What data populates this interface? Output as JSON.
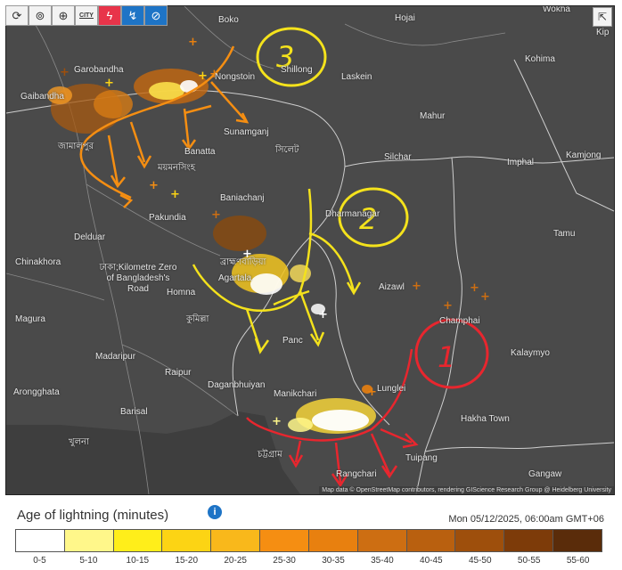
{
  "toolbar": {
    "icons": [
      "refresh-icon",
      "location-pin-icon",
      "zoom-icon",
      "city-icon",
      "lightning-icon",
      "lightning-ground-icon",
      "satellite-icon"
    ],
    "city_label": "CITY",
    "share_icon": "share-icon"
  },
  "map": {
    "places": [
      {
        "key": "boko",
        "text": "Boko"
      },
      {
        "key": "hojai",
        "text": "Hojai"
      },
      {
        "key": "wokha",
        "text": "Wokha"
      },
      {
        "key": "kip",
        "text": "Kip"
      },
      {
        "key": "kohima",
        "text": "Kohima"
      },
      {
        "key": "garobandha",
        "text": "Garobandha"
      },
      {
        "key": "nongstoin",
        "text": "Nongstoin"
      },
      {
        "key": "shillong",
        "text": "Shillong"
      },
      {
        "key": "laskein",
        "text": "Laskein"
      },
      {
        "key": "gaibandha",
        "text": "Gaibandha"
      },
      {
        "key": "mahur",
        "text": "Mahur"
      },
      {
        "key": "sunamganj",
        "text": "Sunamganj"
      },
      {
        "key": "banatta",
        "text": "Banatta"
      },
      {
        "key": "sylhet_bn",
        "text": "সিলেট"
      },
      {
        "key": "silchar",
        "text": "Silchar"
      },
      {
        "key": "imphal",
        "text": "Imphal"
      },
      {
        "key": "kamjong",
        "text": "Kamjong"
      },
      {
        "key": "baniachanj",
        "text": "Baniachanj"
      },
      {
        "key": "dharmanagar",
        "text": "Dharmanagar"
      },
      {
        "key": "pakundia",
        "text": "Pakundia"
      },
      {
        "key": "delduar",
        "text": "Delduar"
      },
      {
        "key": "tamu",
        "text": "Tamu"
      },
      {
        "key": "chinakhora",
        "text": "Chinakhora"
      },
      {
        "key": "agartala",
        "text": "Agartala"
      },
      {
        "key": "dhaka_road",
        "text": "ঢাকা;Kilometre Zero of Bangladesh's Road"
      },
      {
        "key": "homna",
        "text": "Homna"
      },
      {
        "key": "aizawl",
        "text": "Aizawl"
      },
      {
        "key": "magura",
        "text": "Magura"
      },
      {
        "key": "comilla_bn",
        "text": "কুমিল্লা"
      },
      {
        "key": "champhai",
        "text": "Champhai"
      },
      {
        "key": "panchari",
        "text": "Panc"
      },
      {
        "key": "kalaymyo",
        "text": "Kalaymyo"
      },
      {
        "key": "madaripur",
        "text": "Madaripur"
      },
      {
        "key": "raipur",
        "text": "Raipur"
      },
      {
        "key": "daganbhuiyan",
        "text": "Daganbhuiyan"
      },
      {
        "key": "manikchari",
        "text": "Manikchari"
      },
      {
        "key": "lunglei",
        "text": "Lunglei"
      },
      {
        "key": "arongghata",
        "text": "Arongghata"
      },
      {
        "key": "barisal",
        "text": "Barisal"
      },
      {
        "key": "hakha",
        "text": "Hakha Town"
      },
      {
        "key": "tuipang",
        "text": "Tuipang"
      },
      {
        "key": "gangaw",
        "text": "Gangaw"
      },
      {
        "key": "khulna_bn",
        "text": "খুলনা"
      },
      {
        "key": "chittagong_bn",
        "text": "চট্টগ্রাম"
      },
      {
        "key": "rangamati",
        "text": "Rangchari"
      },
      {
        "key": "mymensingh_bn",
        "text": "ময়মনসিংহ"
      },
      {
        "key": "jamalpur_bn",
        "text": "জামালপুর"
      },
      {
        "key": "brahmanbaria_bn",
        "text": "ব্রাহ্মণবাড়িয়া"
      }
    ],
    "annotations": [
      {
        "number": "1",
        "color": "#e8262e"
      },
      {
        "number": "2",
        "color": "#f4e21c"
      },
      {
        "number": "3",
        "color": "#f4e21c"
      }
    ],
    "attribution": "Map data © OpenStreetMap contributors, rendering GIScience Research Group @ Heidelberg University"
  },
  "legend": {
    "title": "Age of lightning (minutes)",
    "info_icon": "info-icon",
    "timestamp": "Mon 05/12/2025, 06:00am GMT+06",
    "colors": [
      "#ffffff",
      "#fff78a",
      "#ffee1a",
      "#fcd414",
      "#f9b81b",
      "#f58e12",
      "#e8800f",
      "#cd6e12",
      "#b9600f",
      "#9e4f0c",
      "#7d3b09",
      "#5a2c0a"
    ],
    "labels": [
      "0-5",
      "5-10",
      "10-15",
      "15-20",
      "20-25",
      "25-30",
      "30-35",
      "35-40",
      "40-45",
      "45-50",
      "50-55",
      "55-60"
    ]
  }
}
